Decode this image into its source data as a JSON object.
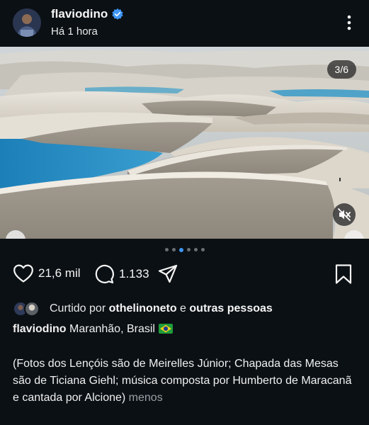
{
  "post": {
    "username": "flaviodino",
    "timestamp": "Há 1 hora",
    "image_counter": "3/6",
    "carousel": {
      "total": 6,
      "active_index": 2
    },
    "likes": "21,6 mil",
    "comments": "1.133",
    "liked_by_prefix": "Curtido por",
    "liked_by_user": "othelinoneto",
    "liked_by_connector": "e",
    "liked_by_others": "outras pessoas",
    "caption_username": "flaviodino",
    "caption_location": "Maranhão, Brasil",
    "caption_text": "(Fotos dos Lençóis são de Meirelles Júnior; Chapada das Mesas são de Ticiana Giehl; música composta por Humberto de Maracanã e cantada por Alcione)",
    "less_label": "menos"
  },
  "icons": {
    "more": "more-vertical-icon",
    "verified": "verified-badge-icon",
    "like": "heart-icon",
    "comment": "comment-bubble-icon",
    "share": "paper-plane-icon",
    "save": "bookmark-icon",
    "mute": "muted-speaker-icon",
    "flag": "brazil-flag-icon"
  },
  "colors": {
    "background": "#0b1014",
    "accent": "#3f96f5",
    "muted_text": "#9aa0a6"
  }
}
